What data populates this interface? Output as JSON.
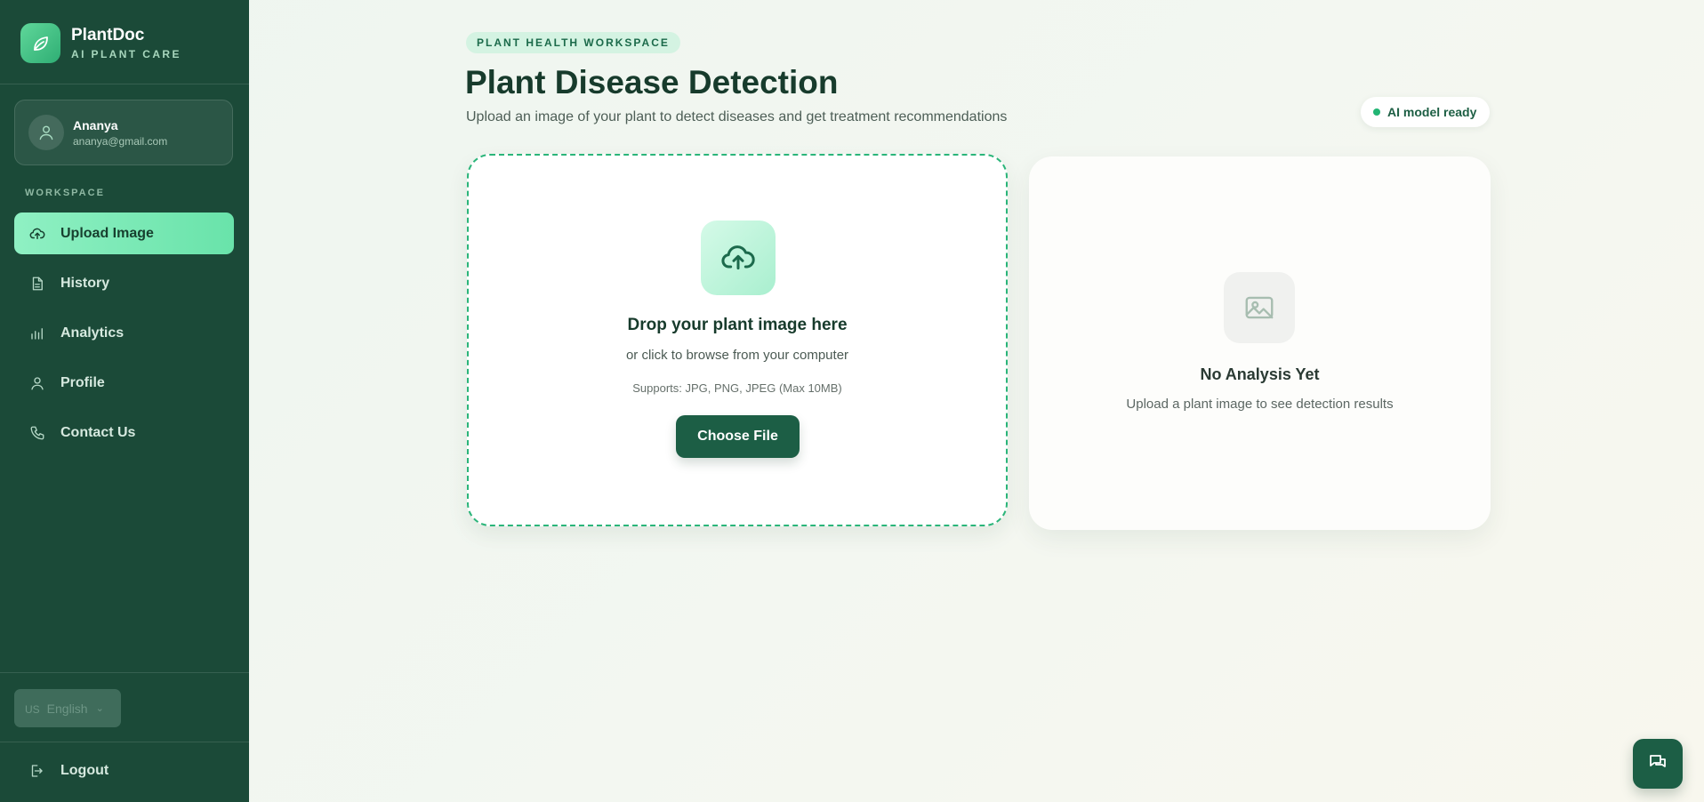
{
  "brand": {
    "name": "PlantDoc",
    "tagline": "AI PLANT CARE"
  },
  "user": {
    "name": "Ananya",
    "email": "ananya@gmail.com"
  },
  "sidebar": {
    "section_label": "WORKSPACE",
    "items": [
      {
        "label": "Upload Image",
        "icon": "cloud-upload-icon",
        "active": true
      },
      {
        "label": "History",
        "icon": "document-icon",
        "active": false
      },
      {
        "label": "Analytics",
        "icon": "bar-chart-icon",
        "active": false
      },
      {
        "label": "Profile",
        "icon": "user-icon",
        "active": false
      },
      {
        "label": "Contact Us",
        "icon": "phone-icon",
        "active": false
      }
    ],
    "language": {
      "flag": "US",
      "value": "English"
    },
    "logout_label": "Logout"
  },
  "header": {
    "pill": "PLANT HEALTH WORKSPACE",
    "title": "Plant Disease Detection",
    "subtitle": "Upload an image of your plant to detect diseases and get treatment recommendations",
    "status": "AI model ready"
  },
  "upload": {
    "title": "Drop your plant image here",
    "subtitle": "or click to browse from your computer",
    "support": "Supports: JPG, PNG, JPEG (Max 10MB)",
    "button_label": "Choose File"
  },
  "result": {
    "title": "No Analysis Yet",
    "subtitle": "Upload a plant image to see detection results"
  },
  "colors": {
    "sidebar_bg": "#1b4a38",
    "accent": "#22b574",
    "active_nav": "#7cecb8",
    "primary_button": "#1c5e45"
  }
}
